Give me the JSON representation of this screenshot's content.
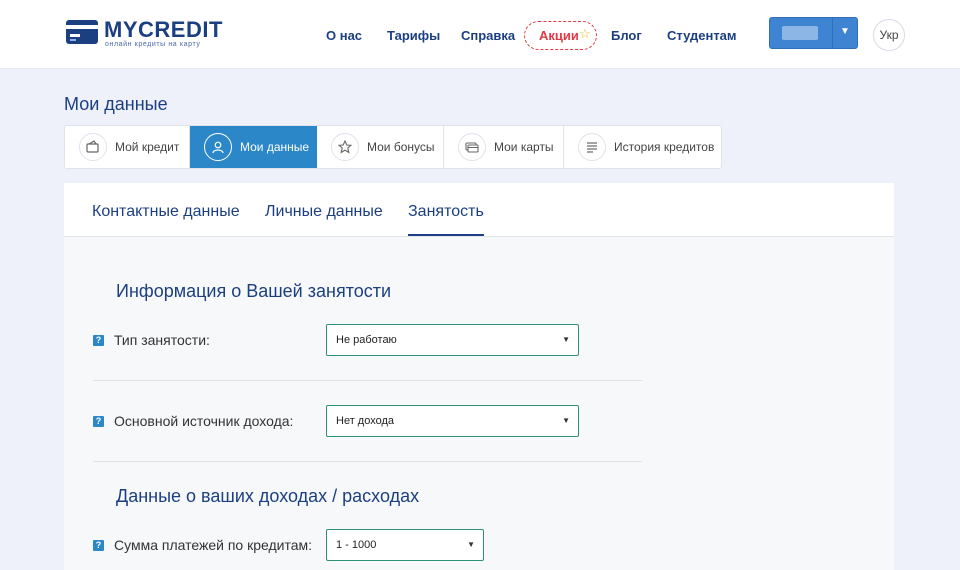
{
  "brand": {
    "name": "MYCREDIT",
    "tagline": "онлайн кредиты на карту",
    "color": "#1c3f82"
  },
  "nav": {
    "items": [
      "О нас",
      "Тарифы",
      "Справка",
      "Блог",
      "Студентам"
    ],
    "promo": {
      "label": "Акции",
      "icon": "star-icon"
    }
  },
  "account": {
    "name": "",
    "menu_icon": "chevron-down-icon"
  },
  "lang": {
    "label": "Укр"
  },
  "page": {
    "title": "Мои данные"
  },
  "tabs": [
    {
      "label": "Мой кредит",
      "icon": "wallet-icon",
      "active": false
    },
    {
      "label": "Мои данные",
      "icon": "user-icon",
      "active": true
    },
    {
      "label": "Мои бонусы",
      "icon": "star-icon",
      "active": false
    },
    {
      "label": "Мои карты",
      "icon": "card-icon",
      "active": false
    },
    {
      "label": "История кредитов",
      "icon": "list-icon",
      "active": false
    }
  ],
  "subtabs": [
    {
      "label": "Контактные данные",
      "active": false
    },
    {
      "label": "Личные данные",
      "active": false
    },
    {
      "label": "Занятость",
      "active": true
    }
  ],
  "sections": {
    "employment": {
      "title": "Информация о Вашей занятости",
      "fields": [
        {
          "help": "?",
          "label": "Тип занятости:",
          "value": "Не работаю"
        },
        {
          "help": "?",
          "label": "Основной источник дохода:",
          "value": "Нет дохода"
        }
      ]
    },
    "income": {
      "title": "Данные о ваших доходах / расходах",
      "fields": [
        {
          "help": "?",
          "label": "Сумма платежей по кредитам:",
          "value": "1 - 1000"
        }
      ]
    }
  },
  "colors": {
    "accent": "#2b87c8",
    "promo": "#e23a44",
    "field_border": "#2d9078",
    "background": "#eef0fa"
  }
}
